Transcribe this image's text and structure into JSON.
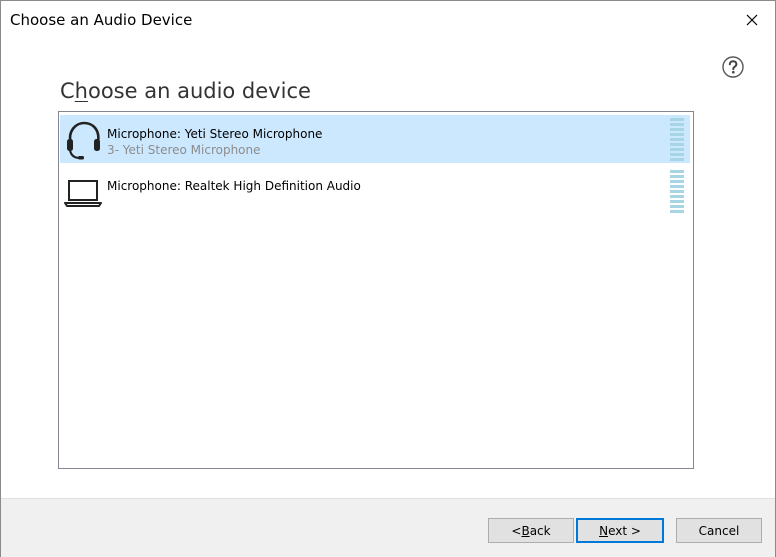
{
  "window": {
    "title": "Choose an Audio Device"
  },
  "help": {
    "icon": "help-icon"
  },
  "heading": {
    "prefix": "C",
    "accel": "h",
    "suffix": "oose an audio device"
  },
  "devices": [
    {
      "name": "Microphone: Yeti Stereo Microphone",
      "subtitle": "3- Yeti Stereo Microphone",
      "icon": "headset-icon",
      "selected": true
    },
    {
      "name": "Microphone: Realtek High Definition Audio",
      "subtitle": "",
      "icon": "laptop-icon",
      "selected": false
    }
  ],
  "buttons": {
    "back": {
      "prefix": "< ",
      "accel": "B",
      "suffix": "ack"
    },
    "next": {
      "accel": "N",
      "suffix": "ext >"
    },
    "cancel": {
      "label": "Cancel"
    }
  },
  "colors": {
    "selection": "#cce8ff",
    "level_meter": "#a7d5e4",
    "default_button_border": "#0078d7",
    "footer": "#f0f0f0"
  }
}
